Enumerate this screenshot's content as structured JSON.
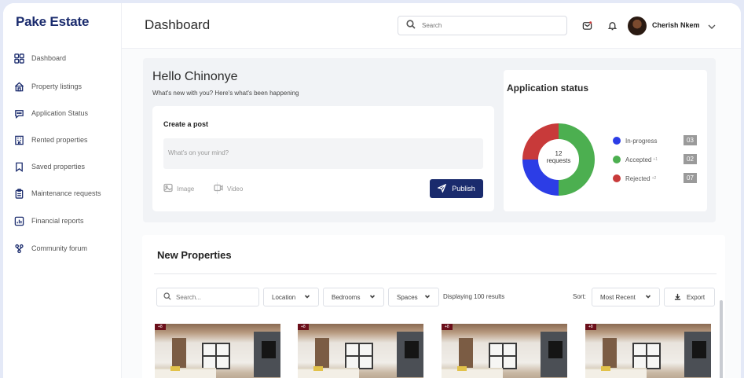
{
  "app": {
    "brand": "Pake Estate"
  },
  "sidebar": {
    "items": [
      {
        "label": "Dashboard",
        "icon": "grid-icon"
      },
      {
        "label": "Property listings",
        "icon": "house-icon"
      },
      {
        "label": "Application Status",
        "icon": "chat-dots-icon"
      },
      {
        "label": "Rented properties",
        "icon": "building-icon"
      },
      {
        "label": "Saved properties",
        "icon": "bookmark-icon"
      },
      {
        "label": "Maintenance requests",
        "icon": "clipboard-icon"
      },
      {
        "label": "Financial reports",
        "icon": "chart-doc-icon"
      },
      {
        "label": "Community forum",
        "icon": "community-icon"
      }
    ]
  },
  "header": {
    "title": "Dashboard",
    "search_placeholder": "Search",
    "user_name": "Cherish Nkem"
  },
  "welcome": {
    "greeting": "Hello Chinonye",
    "subtitle": "What's new with you? Here's what's been happening"
  },
  "post": {
    "title": "Create a post",
    "placeholder": "What's on your mind?",
    "image_label": "Image",
    "video_label": "Video",
    "publish_label": "Publish"
  },
  "application_status": {
    "title": "Application status",
    "total_number": "12",
    "total_word": "requests",
    "statuses": [
      {
        "label": "In-progress",
        "note": "",
        "count": "03",
        "value": 3,
        "color": "#2c3de6"
      },
      {
        "label": "Accepted",
        "note": "+1",
        "count": "02",
        "value": 6,
        "color": "#4caf50"
      },
      {
        "label": "Rejected",
        "note": "+2",
        "count": "07",
        "value": 3,
        "color": "#c83a3a"
      }
    ]
  },
  "properties": {
    "title": "New Properties",
    "search_placeholder": "Search...",
    "filters": [
      "Location",
      "Bedrooms",
      "Spaces"
    ],
    "results_text": "Displaying 100 results",
    "sort_label": "Sort:",
    "sort_value": "Most Recent",
    "export_label": "Export",
    "cards": [
      {
        "badge": "+8"
      },
      {
        "badge": "+8"
      },
      {
        "badge": "+8"
      },
      {
        "badge": "+8"
      }
    ]
  }
}
